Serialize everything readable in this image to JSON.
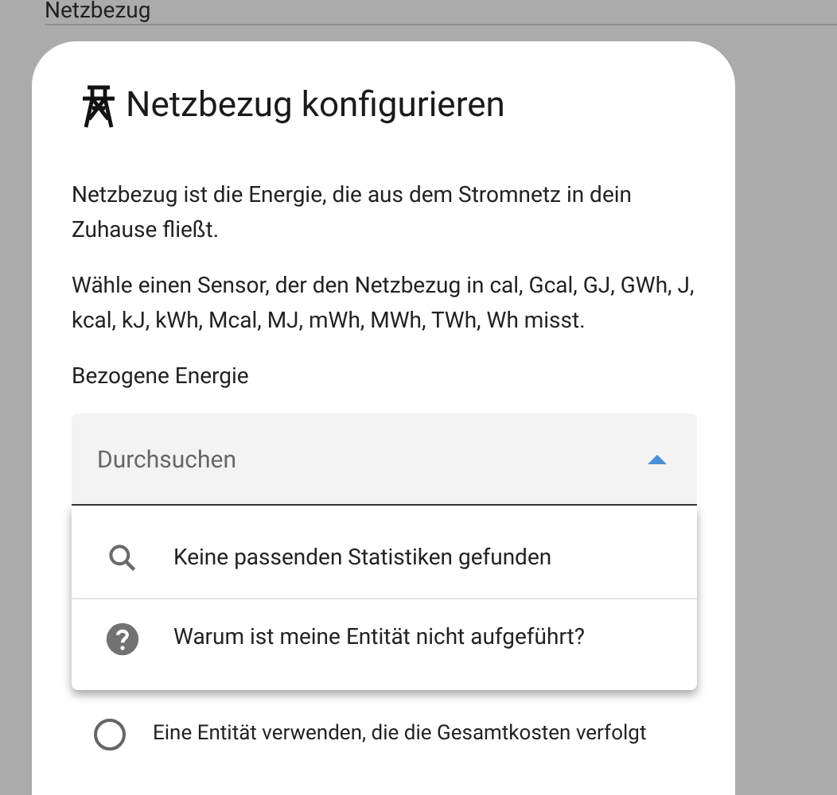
{
  "background_page": {
    "title": "Netzbezug"
  },
  "dialog": {
    "title": "Netzbezug konfigurieren",
    "paragraphs": [
      "Netzbezug ist die Energie, die aus dem Stromnetz in dein Zuhause fließt.",
      "Wähle einen Sensor, der den Netzbezug in cal, Gcal, GJ, GWh, J, kcal, kJ, kWh, Mcal, MJ, mWh, MWh, TWh, Wh misst."
    ],
    "field_label": "Bezogene Energie",
    "search_field": {
      "placeholder": "Durchsuchen",
      "expanded": true
    },
    "dropdown_items": [
      {
        "kind": "search",
        "label": "Keine passenden Statistiken gefunden"
      },
      {
        "kind": "help",
        "label": "Warum ist meine Entität nicht aufgeführt?"
      }
    ],
    "radio_options": [
      {
        "label": "Eine Entität verwenden, die die Gesamtkosten verfolgt",
        "selected": false
      }
    ]
  }
}
